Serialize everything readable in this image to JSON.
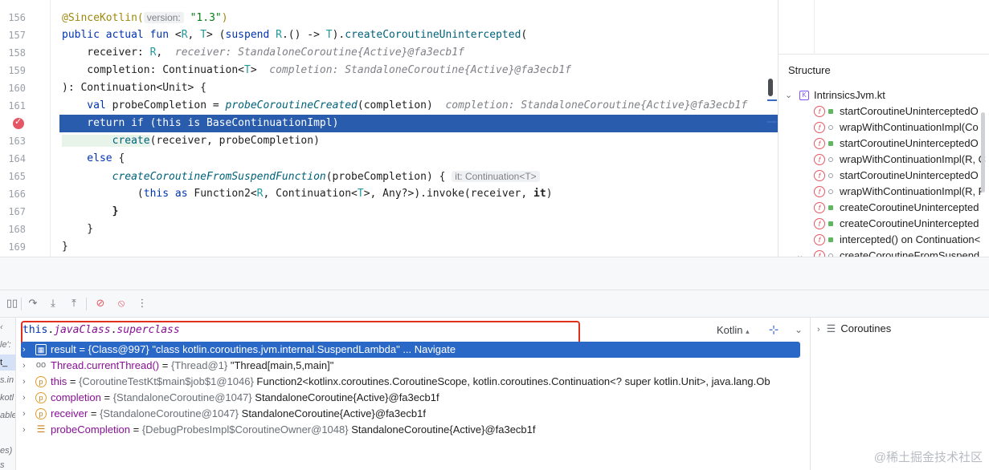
{
  "editor": {
    "lines": [
      {
        "num": "156"
      },
      {
        "num": "157"
      },
      {
        "num": "158"
      },
      {
        "num": "159"
      },
      {
        "num": "160"
      },
      {
        "num": "161"
      },
      {
        "num": "",
        "breakpoint": true
      },
      {
        "num": "163"
      },
      {
        "num": "164"
      },
      {
        "num": "165"
      },
      {
        "num": "166"
      },
      {
        "num": "167"
      },
      {
        "num": "168"
      },
      {
        "num": "169"
      }
    ],
    "code": {
      "l156_ann": "@SinceKotlin(",
      "l156_hint": "version:",
      "l156_str": "\"1.3\"",
      "l156_end": ")",
      "l157_kw": "public actual fun",
      "l157_a": " <",
      "l157_r": "R",
      "l157_b": ", ",
      "l157_t": "T",
      "l157_c": "> (",
      "l157_kw2": "suspend",
      "l157_d": " ",
      "l157_r2": "R",
      "l157_e": ".() -> ",
      "l157_t2": "T",
      "l157_f": ").",
      "l157_fn": "createCoroutineUnintercepted",
      "l157_g": "(",
      "l158_a": "    receiver: ",
      "l158_r": "R",
      "l158_b": ",  ",
      "l158_hint": "receiver: StandaloneCoroutine{Active}@fa3ecb1f",
      "l159_a": "    completion: Continuation<",
      "l159_t": "T",
      "l159_b": ">  ",
      "l159_hint": "completion: StandaloneCoroutine{Active}@fa3ecb1f",
      "l160": "): Continuation<Unit> {",
      "l161_kw": "    val",
      "l161_a": " probeCompletion = ",
      "l161_fn": "probeCoroutineCreated",
      "l161_b": "(completion)  ",
      "l161_hint": "completion: StandaloneCoroutine{Active}@fa3ecb1f",
      "l162_kw": "    return if",
      "l162_a": " (",
      "l162_kw2": "this is",
      "l162_b": " BaseContinuationImpl)",
      "l163_fn": "        create",
      "l163_a": "(receiver, probeCompletion)",
      "l164_kw": "    else",
      "l164_a": " {",
      "l165_fn": "        createCoroutineFromSuspendFunction",
      "l165_a": "(probeCompletion) { ",
      "l165_hint": "it: Continuation<T>",
      "l166_a": "            (",
      "l166_kw": "this as",
      "l166_b": " Function2<",
      "l166_r": "R",
      "l166_c": ", Continuation<",
      "l166_t": "T",
      "l166_d": ">, Any?>).invoke(receiver, ",
      "l166_it": "it",
      "l166_e": ")",
      "l167": "        }",
      "l168": "    }",
      "l169": "}"
    }
  },
  "structure": {
    "title": "Structure",
    "file": "IntrinsicsJvm.kt",
    "items": [
      {
        "label": "startCoroutineUninterceptedO",
        "vis": "pub"
      },
      {
        "label": "wrapWithContinuationImpl(Co",
        "vis": "priv"
      },
      {
        "label": "startCoroutineUninterceptedO",
        "vis": "pub"
      },
      {
        "label": "wrapWithContinuationImpl(R, C",
        "vis": "priv"
      },
      {
        "label": "startCoroutineUninterceptedO",
        "vis": "priv"
      },
      {
        "label": "wrapWithContinuationImpl(R, P",
        "vis": "priv"
      },
      {
        "label": "createCoroutineUnintercepted",
        "vis": "pub"
      },
      {
        "label": "createCoroutineUnintercepted",
        "vis": "pub"
      },
      {
        "label": "intercepted() on Continuation<",
        "vis": "pub"
      },
      {
        "label": "createCoroutineFromSuspend",
        "vis": "priv"
      }
    ]
  },
  "frames": [
    "t_",
    "le':",
    "s.in",
    "kotl",
    "able",
    "",
    "",
    "",
    "es)",
    "s"
  ],
  "debugger": {
    "expression_kw": "this",
    "expression_dot": ".",
    "expression_p1": "javaClass",
    "expression_dot2": ".",
    "expression_p2": "superclass",
    "language": "Kotlin",
    "variables": [
      {
        "icon": "grid",
        "name": "result",
        "eq": " = ",
        "type": "{Class@997}",
        "value": " \"class kotlin.coroutines.jvm.internal.SuspendLambda\" ... Navigate",
        "selected": true
      },
      {
        "icon": "oo",
        "name": "Thread.currentThread()",
        "eq": " = ",
        "type": "{Thread@1}",
        "value": " \"Thread[main,5,main]\""
      },
      {
        "icon": "p",
        "name": "this",
        "eq": " = ",
        "type": "{CoroutineTestKt$main$job$1@1046}",
        "value": " Function2<kotlinx.coroutines.CoroutineScope, kotlin.coroutines.Continuation<? super kotlin.Unit>, java.lang.Ob"
      },
      {
        "icon": "p",
        "name": "completion",
        "eq": " = ",
        "type": "{StandaloneCoroutine@1047}",
        "value": " StandaloneCoroutine{Active}@fa3ecb1f"
      },
      {
        "icon": "p",
        "name": "receiver",
        "eq": " = ",
        "type": "{StandaloneCoroutine@1047}",
        "value": " StandaloneCoroutine{Active}@fa3ecb1f"
      },
      {
        "icon": "stack",
        "name": "probeCompletion",
        "eq": " = ",
        "type": "{DebugProbesImpl$CoroutineOwner@1048}",
        "value": " StandaloneCoroutine{Active}@fa3ecb1f"
      }
    ]
  },
  "coroutines": {
    "label": "Coroutines"
  },
  "watermark": "@稀土掘金技术社区",
  "icons": {
    "toolbar": [
      "layout-icon",
      "step-over-icon",
      "step-into-icon",
      "step-out-icon",
      "view-breakpoints-icon",
      "mute-breakpoints-icon",
      "more-icon"
    ]
  }
}
